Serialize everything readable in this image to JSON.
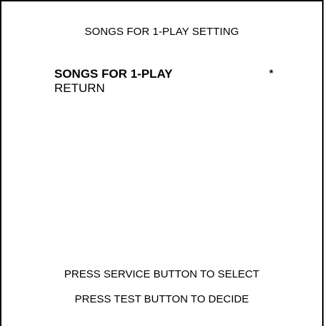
{
  "screen": {
    "title": "SONGS FOR 1-PLAY SETTING"
  },
  "menu": {
    "items": [
      {
        "label": "SONGS FOR 1-PLAY",
        "value": "*",
        "selected": true
      },
      {
        "label": "RETURN",
        "value": "",
        "selected": false
      }
    ]
  },
  "footer": {
    "line1": "PRESS SERVICE BUTTON TO SELECT",
    "line2": "PRESS TEST BUTTON TO DECIDE"
  }
}
